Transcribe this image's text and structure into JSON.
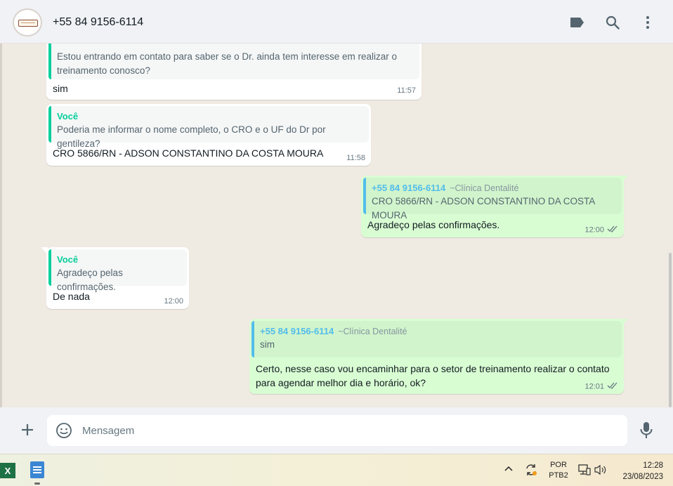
{
  "header": {
    "contact_name": "+55 84 9156-6114",
    "icons": [
      "label-icon",
      "search-icon",
      "more-vert-icon"
    ]
  },
  "messages": [
    {
      "direction": "in",
      "quote_text": "Estou entrando em contato para saber se o Dr. ainda tem interesse em realizar o treinamento conosco?",
      "text": "sim",
      "time": "11:57"
    },
    {
      "direction": "in",
      "quote_author": "Você",
      "quote_text": "Poderia me informar o nome completo, o CRO e o UF do Dr por gentileza?",
      "text": "CRO 5866/RN - ADSON CONSTANTINO DA COSTA MOURA",
      "time": "11:58"
    },
    {
      "direction": "out",
      "quote_author": "+55 84 9156-6114",
      "quote_sub": "~Clínica Dentalité",
      "quote_text": "CRO 5866/RN - ADSON CONSTANTINO DA COSTA MOURA",
      "text": "Agradeço pelas confirmações.",
      "time": "12:00"
    },
    {
      "direction": "in",
      "quote_author": "Você",
      "quote_text": "Agradeço pelas confirmações.",
      "text": "De nada",
      "time": "12:00"
    },
    {
      "direction": "out",
      "quote_author": "+55 84 9156-6114",
      "quote_sub": "~Clínica Dentalité",
      "quote_text": "sim",
      "text": "Certo, nesse caso vou encaminhar para o setor de treinamento realizar o contato para agendar melhor dia e horário, ok?",
      "time": "12:01"
    }
  ],
  "composer": {
    "placeholder": "Mensagem"
  },
  "taskbar": {
    "excel_label": "X",
    "lang_line1": "POR",
    "lang_line2": "PTB2",
    "time": "12:28",
    "date": "23/08/2023"
  },
  "colors": {
    "chat_bg": "#efeae2",
    "outgoing_bubble": "#d9fdd3",
    "incoming_bubble": "#ffffff",
    "quote_you": "#06cf9c",
    "quote_contact": "#53bdeb",
    "read_ticks": "#667781"
  }
}
